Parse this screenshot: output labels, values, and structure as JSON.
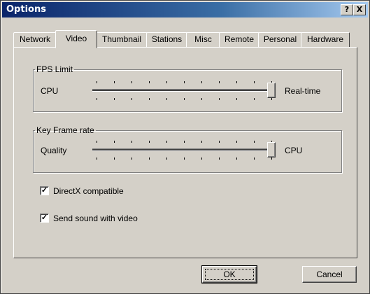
{
  "window": {
    "title": "Options",
    "help_label": "?",
    "close_label": "X"
  },
  "tabs": [
    {
      "label": "Network"
    },
    {
      "label": "Video"
    },
    {
      "label": "Thumbnail"
    },
    {
      "label": "Stations"
    },
    {
      "label": "Misc"
    },
    {
      "label": "Remote"
    },
    {
      "label": "Personal"
    },
    {
      "label": "Hardware"
    }
  ],
  "active_tab": "Video",
  "fps_limit": {
    "group_label": "FPS Limit",
    "left_label": "CPU",
    "right_label": "Real-time",
    "value_fraction": 1.0
  },
  "key_frame_rate": {
    "group_label": "Key Frame rate",
    "left_label": "Quality",
    "right_label": "CPU",
    "value_fraction": 1.0
  },
  "checkboxes": [
    {
      "label": "DirectX compatible",
      "checked": true
    },
    {
      "label": "Send sound with video",
      "checked": true
    }
  ],
  "buttons": {
    "ok": "OK",
    "cancel": "Cancel"
  },
  "check_glyph": "✓"
}
